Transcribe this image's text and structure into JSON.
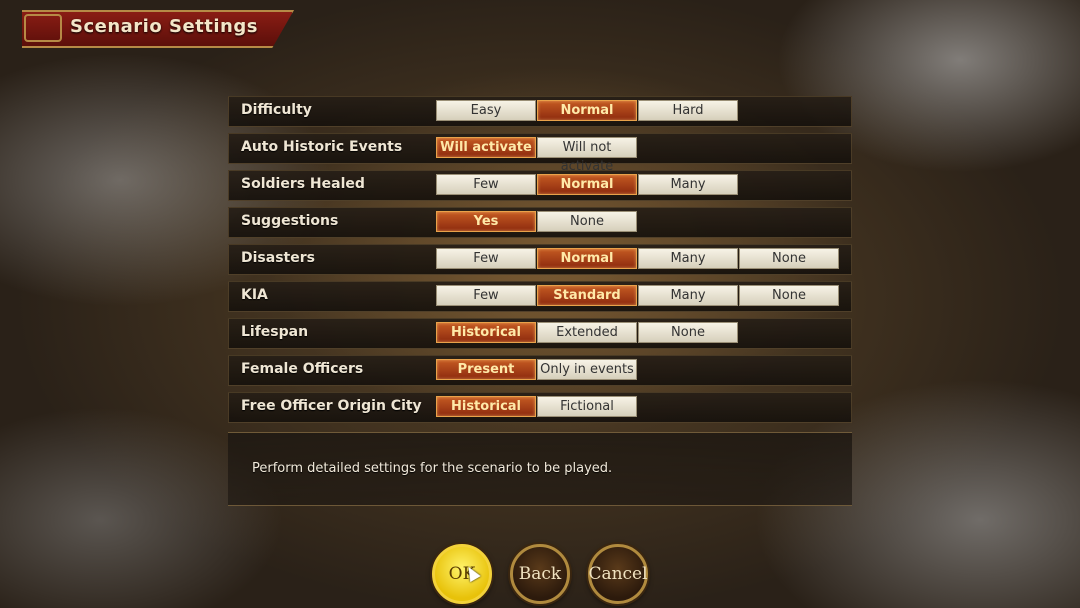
{
  "title": "Scenario Settings",
  "settings": [
    {
      "label": "Difficulty",
      "options": [
        "Easy",
        "Normal",
        "Hard"
      ],
      "selected": 1
    },
    {
      "label": "Auto Historic Events",
      "options": [
        "Will activate",
        "Will not activate"
      ],
      "selected": 0
    },
    {
      "label": "Soldiers Healed",
      "options": [
        "Few",
        "Normal",
        "Many"
      ],
      "selected": 1
    },
    {
      "label": "Suggestions",
      "options": [
        "Yes",
        "None"
      ],
      "selected": 0
    },
    {
      "label": "Disasters",
      "options": [
        "Few",
        "Normal",
        "Many",
        "None"
      ],
      "selected": 1
    },
    {
      "label": "KIA",
      "options": [
        "Few",
        "Standard",
        "Many",
        "None"
      ],
      "selected": 1
    },
    {
      "label": "Lifespan",
      "options": [
        "Historical",
        "Extended",
        "None"
      ],
      "selected": 0
    },
    {
      "label": "Female Officers",
      "options": [
        "Present",
        "Only in events"
      ],
      "selected": 0
    },
    {
      "label": "Free Officer Origin City",
      "options": [
        "Historical",
        "Fictional"
      ],
      "selected": 0
    }
  ],
  "description": "Perform detailed settings for the scenario to be played.",
  "buttons": {
    "ok": "OK",
    "back": "Back",
    "cancel": "Cancel"
  }
}
